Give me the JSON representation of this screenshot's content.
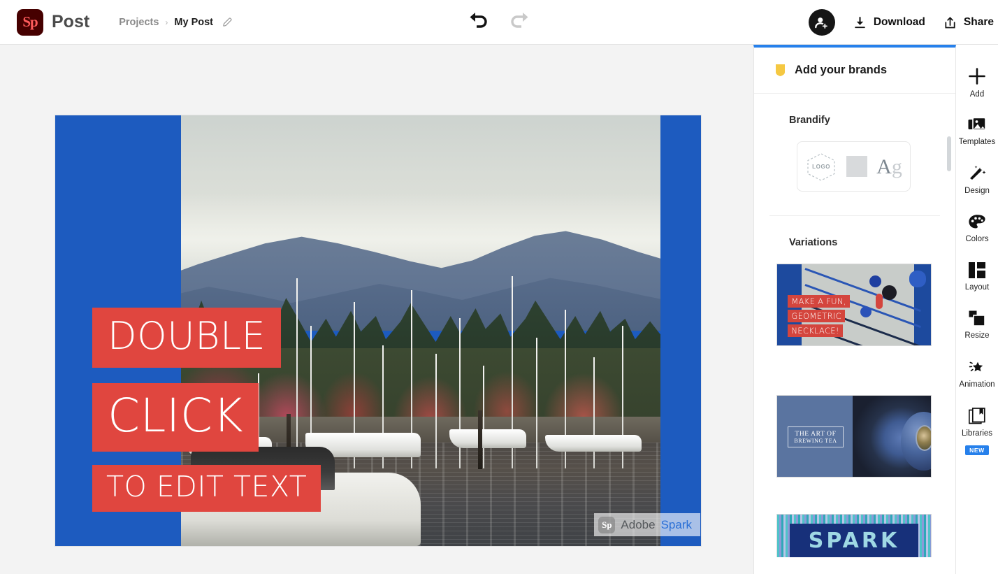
{
  "header": {
    "logo_text": "Sp",
    "app_name": "Post",
    "breadcrumb": {
      "parent": "Projects",
      "separator": "›",
      "current": "My Post",
      "edit_icon": "pencil-icon"
    },
    "history": {
      "undo_icon": "undo-arrow-icon",
      "redo_icon": "redo-arrow-icon",
      "undo_state": "enabled",
      "redo_state": "disabled"
    },
    "actions": {
      "invite_icon": "add-person-icon",
      "download_label": "Download",
      "download_icon": "download-arrow-icon",
      "share_label": "Share",
      "share_icon": "share-box-icon"
    }
  },
  "canvas": {
    "background_color": "#1D5BBF",
    "text_block_color": "#E0463F",
    "text_color": "#FFFFFF",
    "lines": [
      "DOUBLE",
      "CLICK",
      "TO EDIT TEXT"
    ],
    "photo_description": "marina-with-sailboats-and-mountains",
    "watermark": {
      "logo_text": "Sp",
      "word1": "Adobe",
      "word2": "Spark",
      "word2_color": "#2A6FD6"
    }
  },
  "panel": {
    "accent_color": "#2680EB",
    "shield_icon": "shield-icon",
    "shield_color": "#F5C842",
    "title": "Add your brands",
    "brandify": {
      "title": "Brandify",
      "logo_placeholder": "LOGO",
      "color_swatch_icon": "color-swatch-icon",
      "type_sample_a": "A",
      "type_sample_g": "g"
    },
    "variations": {
      "title": "Variations",
      "items": [
        {
          "name": "geometric-necklace",
          "lines": [
            "MAKE A FUN,",
            "GEOMETRIC",
            "NECKLACE!"
          ]
        },
        {
          "name": "brewing-tea",
          "line1": "THE ART OF",
          "line2": "BREWING TEA"
        },
        {
          "name": "spark",
          "word": "SPARK"
        }
      ]
    }
  },
  "rail": {
    "items": [
      {
        "label": "Add",
        "icon": "plus-icon"
      },
      {
        "label": "Templates",
        "icon": "image-stack-icon"
      },
      {
        "label": "Design",
        "icon": "magic-wand-icon"
      },
      {
        "label": "Colors",
        "icon": "palette-icon"
      },
      {
        "label": "Layout",
        "icon": "layout-grid-icon"
      },
      {
        "label": "Resize",
        "icon": "resize-squares-icon"
      },
      {
        "label": "Animation",
        "icon": "sparkle-star-icon"
      },
      {
        "label": "Libraries",
        "icon": "libraries-book-icon",
        "badge": "NEW"
      }
    ]
  }
}
